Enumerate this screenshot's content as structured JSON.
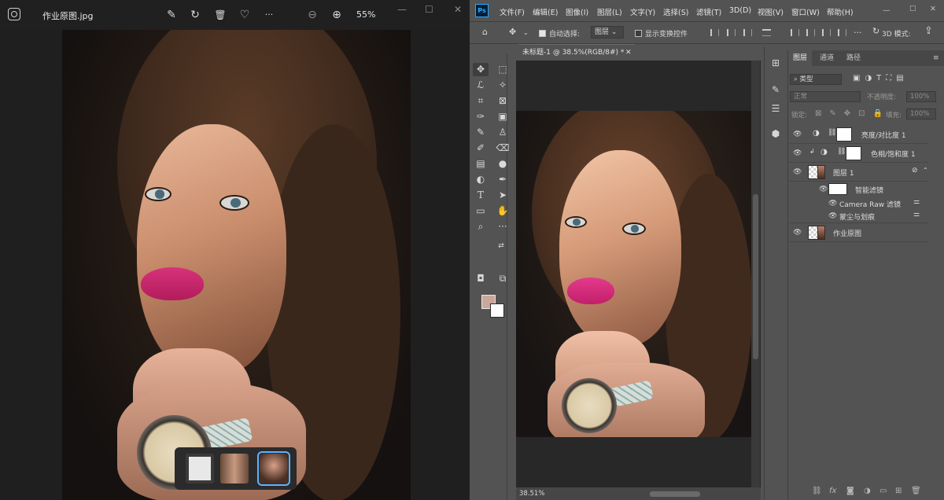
{
  "viewer": {
    "filename": "作业原图.jpg",
    "zoom": "55%",
    "toolbar_icons": [
      "edit-icon",
      "rotate-icon",
      "delete-icon",
      "favorite-icon",
      "more-icon",
      "zoom-out-icon",
      "zoom-in-icon"
    ],
    "glyphs": {
      "edit": "✎",
      "rotate": "↻",
      "delete": "🗑",
      "favorite": "♡",
      "more": "···",
      "zoom_out": "⊖",
      "zoom_in": "⊕",
      "minimize": "—",
      "maximize": "☐",
      "close": "✕"
    }
  },
  "photoshop": {
    "logo": "Ps",
    "menu": [
      "文件(F)",
      "编辑(E)",
      "图像(I)",
      "图层(L)",
      "文字(Y)",
      "选择(S)",
      "滤镜(T)",
      "3D(D)",
      "视图(V)",
      "窗口(W)",
      "帮助(H)"
    ],
    "options": {
      "auto_select_label": "自动选择:",
      "auto_select_value": "图层",
      "show_transform_label": "显示变换控件",
      "mode_3d": "3D 模式:"
    },
    "document_tab": "未标题-1 @ 38.5%(RGB/8#) *",
    "status_zoom": "38.51%",
    "foreground_color": "#c9a79b",
    "background_color": "#ffffff",
    "layers_panel": {
      "tabs": [
        "图层",
        "通道",
        "路径"
      ],
      "filter_kind": "类型",
      "blend_mode": "正常",
      "opacity_label": "不透明度:",
      "opacity_value": "100%",
      "lock_label": "锁定:",
      "fill_label": "填充:",
      "fill_value": "100%",
      "layers": [
        {
          "name": "亮度/对比度 1"
        },
        {
          "name": "色相/饱和度 1"
        },
        {
          "name": "图层 1"
        },
        {
          "name": "智能滤镜"
        },
        {
          "name": "Camera Raw 滤镜"
        },
        {
          "name": "蒙尘与划痕"
        },
        {
          "name": "作业原图"
        }
      ]
    }
  }
}
